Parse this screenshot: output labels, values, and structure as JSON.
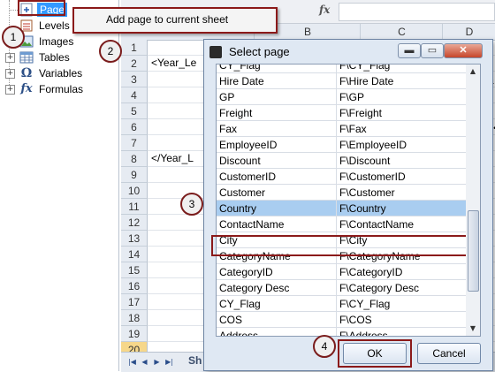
{
  "tree": {
    "items": [
      {
        "label": "Page",
        "icon": "page-icon"
      },
      {
        "label": "Levels",
        "icon": "levels-icon"
      },
      {
        "label": "Images",
        "icon": "images-icon"
      },
      {
        "label": "Tables",
        "icon": "tables-icon"
      },
      {
        "label": "Variables",
        "icon": "omega-icon",
        "glyph": "Ω"
      },
      {
        "label": "Formulas",
        "icon": "fx-icon",
        "glyph": "fx"
      }
    ]
  },
  "context_menu": {
    "item": "Add page to current sheet"
  },
  "callouts": [
    "1",
    "2",
    "3",
    "4"
  ],
  "sheet": {
    "formula_symbol": "fx",
    "columns": [
      "B",
      "C",
      "D"
    ],
    "rows": [
      "1",
      "2",
      "3",
      "4",
      "5",
      "6",
      "7",
      "8",
      "9",
      "10",
      "11",
      "12",
      "13",
      "14",
      "15",
      "16",
      "17",
      "18",
      "19",
      "20"
    ],
    "selected_row": "20",
    "cells": {
      "row2": "<Year_Le",
      "row8": "</Year_L"
    },
    "sheet_tab": "Sh",
    "right_glyphs": [
      "a",
      "p."
    ]
  },
  "dialog": {
    "title": "Select page",
    "list": [
      {
        "name": "CY_Flag",
        "path": "F\\CY_Flag"
      },
      {
        "name": "Hire Date",
        "path": "F\\Hire Date"
      },
      {
        "name": "GP",
        "path": "F\\GP"
      },
      {
        "name": "Freight",
        "path": "F\\Freight"
      },
      {
        "name": "Fax",
        "path": "F\\Fax"
      },
      {
        "name": "EmployeeID",
        "path": "F\\EmployeeID"
      },
      {
        "name": "Discount",
        "path": "F\\Discount"
      },
      {
        "name": "CustomerID",
        "path": "F\\CustomerID"
      },
      {
        "name": "Customer",
        "path": "F\\Customer"
      },
      {
        "name": "Country",
        "path": "F\\Country"
      },
      {
        "name": "ContactName",
        "path": "F\\ContactName"
      },
      {
        "name": "City",
        "path": "F\\City"
      },
      {
        "name": "CategoryName",
        "path": "F\\CategoryName"
      },
      {
        "name": "CategoryID",
        "path": "F\\CategoryID"
      },
      {
        "name": "Category Desc",
        "path": "F\\Category Desc"
      },
      {
        "name": "CY_Flag",
        "path": "F\\CY_Flag"
      },
      {
        "name": "COS",
        "path": "F\\COS"
      },
      {
        "name": "Address",
        "path": "F\\Address"
      }
    ],
    "selected_index": 9,
    "ok_label": "OK",
    "cancel_label": "Cancel",
    "minimize_glyph": "▬",
    "maximize_glyph": "▭",
    "close_glyph": "✕"
  },
  "colors": {
    "accent_red": "#8b1a1a",
    "selection_blue": "#a9cdf0",
    "row_highlight": "#f6d78a"
  }
}
